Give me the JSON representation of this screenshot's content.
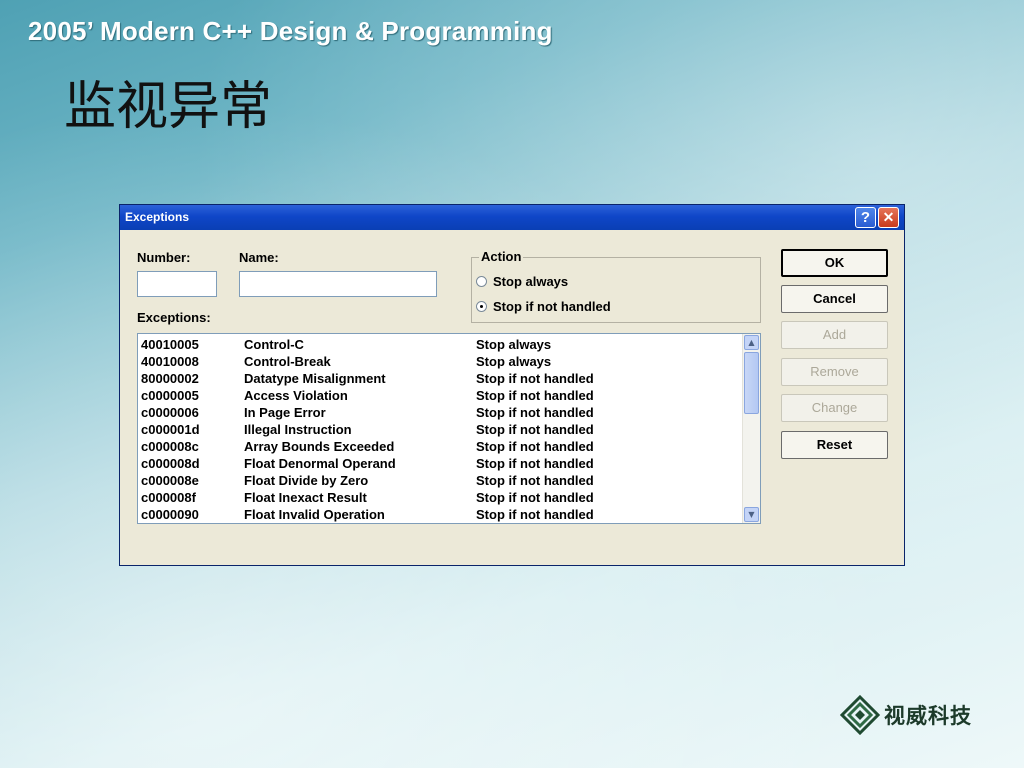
{
  "slide": {
    "header": "2005’ Modern C++ Design & Programming",
    "title": "监视异常",
    "logo_text": "视威科技"
  },
  "dialog": {
    "title": "Exceptions",
    "help_glyph": "?",
    "close_glyph": "✕",
    "number_label": "Number:",
    "number_value": "",
    "name_label": "Name:",
    "name_value": "",
    "exceptions_label": "Exceptions:",
    "action": {
      "legend": "Action",
      "options": [
        {
          "label": "Stop always",
          "selected": false
        },
        {
          "label": "Stop if not handled",
          "selected": true
        }
      ]
    },
    "buttons": {
      "ok": "OK",
      "cancel": "Cancel",
      "add": "Add",
      "remove": "Remove",
      "change": "Change",
      "reset": "Reset"
    },
    "exceptions": [
      {
        "code": "40010005",
        "name": "Control-C",
        "action": "Stop always"
      },
      {
        "code": "40010008",
        "name": "Control-Break",
        "action": "Stop always"
      },
      {
        "code": "80000002",
        "name": "Datatype Misalignment",
        "action": "Stop if not handled"
      },
      {
        "code": "c0000005",
        "name": "Access Violation",
        "action": "Stop if not handled"
      },
      {
        "code": "c0000006",
        "name": "In Page Error",
        "action": "Stop if not handled"
      },
      {
        "code": "c000001d",
        "name": "Illegal Instruction",
        "action": "Stop if not handled"
      },
      {
        "code": "c000008c",
        "name": "Array Bounds Exceeded",
        "action": "Stop if not handled"
      },
      {
        "code": "c000008d",
        "name": "Float Denormal Operand",
        "action": "Stop if not handled"
      },
      {
        "code": "c000008e",
        "name": "Float Divide by Zero",
        "action": "Stop if not handled"
      },
      {
        "code": "c000008f",
        "name": "Float Inexact Result",
        "action": "Stop if not handled"
      },
      {
        "code": "c0000090",
        "name": "Float Invalid Operation",
        "action": "Stop if not handled"
      }
    ]
  }
}
